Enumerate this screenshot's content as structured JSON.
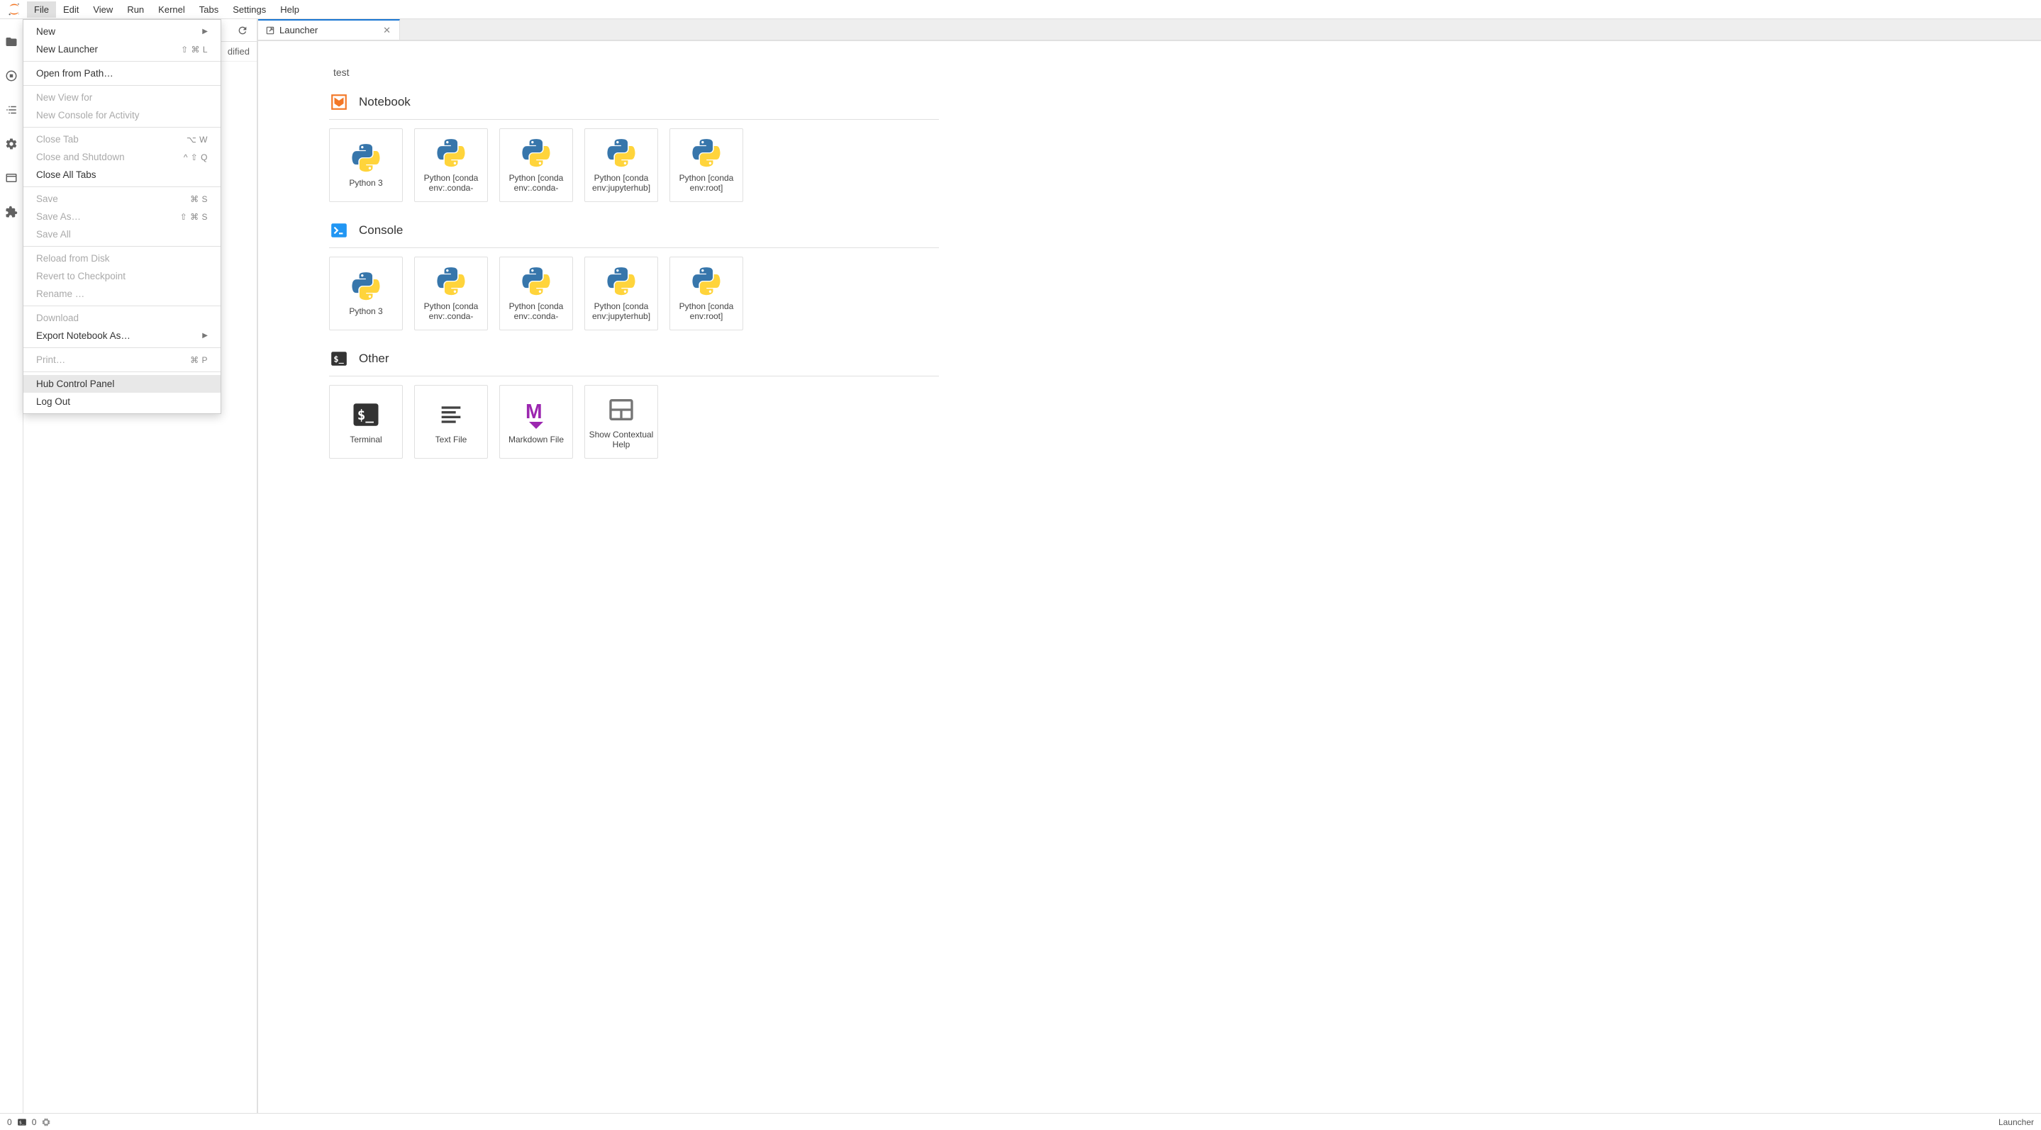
{
  "menu": {
    "items": [
      "File",
      "Edit",
      "View",
      "Run",
      "Kernel",
      "Tabs",
      "Settings",
      "Help"
    ],
    "active_index": 0
  },
  "file_menu": [
    {
      "label": "New",
      "shortcut": "",
      "submenu": true,
      "disabled": false
    },
    {
      "label": "New Launcher",
      "shortcut": "⇧ ⌘ L",
      "disabled": false
    },
    {
      "sep": true
    },
    {
      "label": "Open from Path…",
      "shortcut": "",
      "disabled": false
    },
    {
      "sep": true
    },
    {
      "label": "New View for",
      "shortcut": "",
      "disabled": true
    },
    {
      "label": "New Console for Activity",
      "shortcut": "",
      "disabled": true
    },
    {
      "sep": true
    },
    {
      "label": "Close Tab",
      "shortcut": "⌥ W",
      "disabled": true
    },
    {
      "label": "Close and Shutdown",
      "shortcut": "^ ⇧ Q",
      "disabled": true
    },
    {
      "label": "Close All Tabs",
      "shortcut": "",
      "disabled": false
    },
    {
      "sep": true
    },
    {
      "label": "Save",
      "shortcut": "⌘ S",
      "disabled": true
    },
    {
      "label": "Save As…",
      "shortcut": "⇧ ⌘ S",
      "disabled": true
    },
    {
      "label": "Save All",
      "shortcut": "",
      "disabled": true
    },
    {
      "sep": true
    },
    {
      "label": "Reload from Disk",
      "shortcut": "",
      "disabled": true
    },
    {
      "label": "Revert to Checkpoint",
      "shortcut": "",
      "disabled": true
    },
    {
      "label": "Rename …",
      "shortcut": "",
      "disabled": true
    },
    {
      "sep": true
    },
    {
      "label": "Download",
      "shortcut": "",
      "disabled": true
    },
    {
      "label": "Export Notebook As…",
      "shortcut": "",
      "submenu": true,
      "disabled": false
    },
    {
      "sep": true
    },
    {
      "label": "Print…",
      "shortcut": "⌘ P",
      "disabled": true
    },
    {
      "sep": true
    },
    {
      "label": "Hub Control Panel",
      "shortcut": "",
      "disabled": false,
      "hover": true
    },
    {
      "label": "Log Out",
      "shortcut": "",
      "disabled": false
    }
  ],
  "file_browser": {
    "column_header": "dified"
  },
  "tab": {
    "label": "Launcher"
  },
  "launcher": {
    "cwd": "test",
    "sections": [
      {
        "title": "Notebook",
        "icon": "notebook",
        "cards": [
          {
            "label": "Python 3",
            "icon": "python"
          },
          {
            "label": "Python [conda env:.conda-",
            "icon": "python"
          },
          {
            "label": "Python [conda env:.conda-",
            "icon": "python"
          },
          {
            "label": "Python [conda env:jupyterhub]",
            "icon": "python"
          },
          {
            "label": "Python [conda env:root]",
            "icon": "python"
          }
        ]
      },
      {
        "title": "Console",
        "icon": "console",
        "cards": [
          {
            "label": "Python 3",
            "icon": "python"
          },
          {
            "label": "Python [conda env:.conda-",
            "icon": "python"
          },
          {
            "label": "Python [conda env:.conda-",
            "icon": "python"
          },
          {
            "label": "Python [conda env:jupyterhub]",
            "icon": "python"
          },
          {
            "label": "Python [conda env:root]",
            "icon": "python"
          }
        ]
      },
      {
        "title": "Other",
        "icon": "terminal",
        "cards": [
          {
            "label": "Terminal",
            "icon": "terminal-card"
          },
          {
            "label": "Text File",
            "icon": "textfile"
          },
          {
            "label": "Markdown File",
            "icon": "markdown"
          },
          {
            "label": "Show Contextual Help",
            "icon": "help"
          }
        ]
      }
    ]
  },
  "status": {
    "terminals": "0",
    "kernels": "0",
    "right": "Launcher"
  }
}
